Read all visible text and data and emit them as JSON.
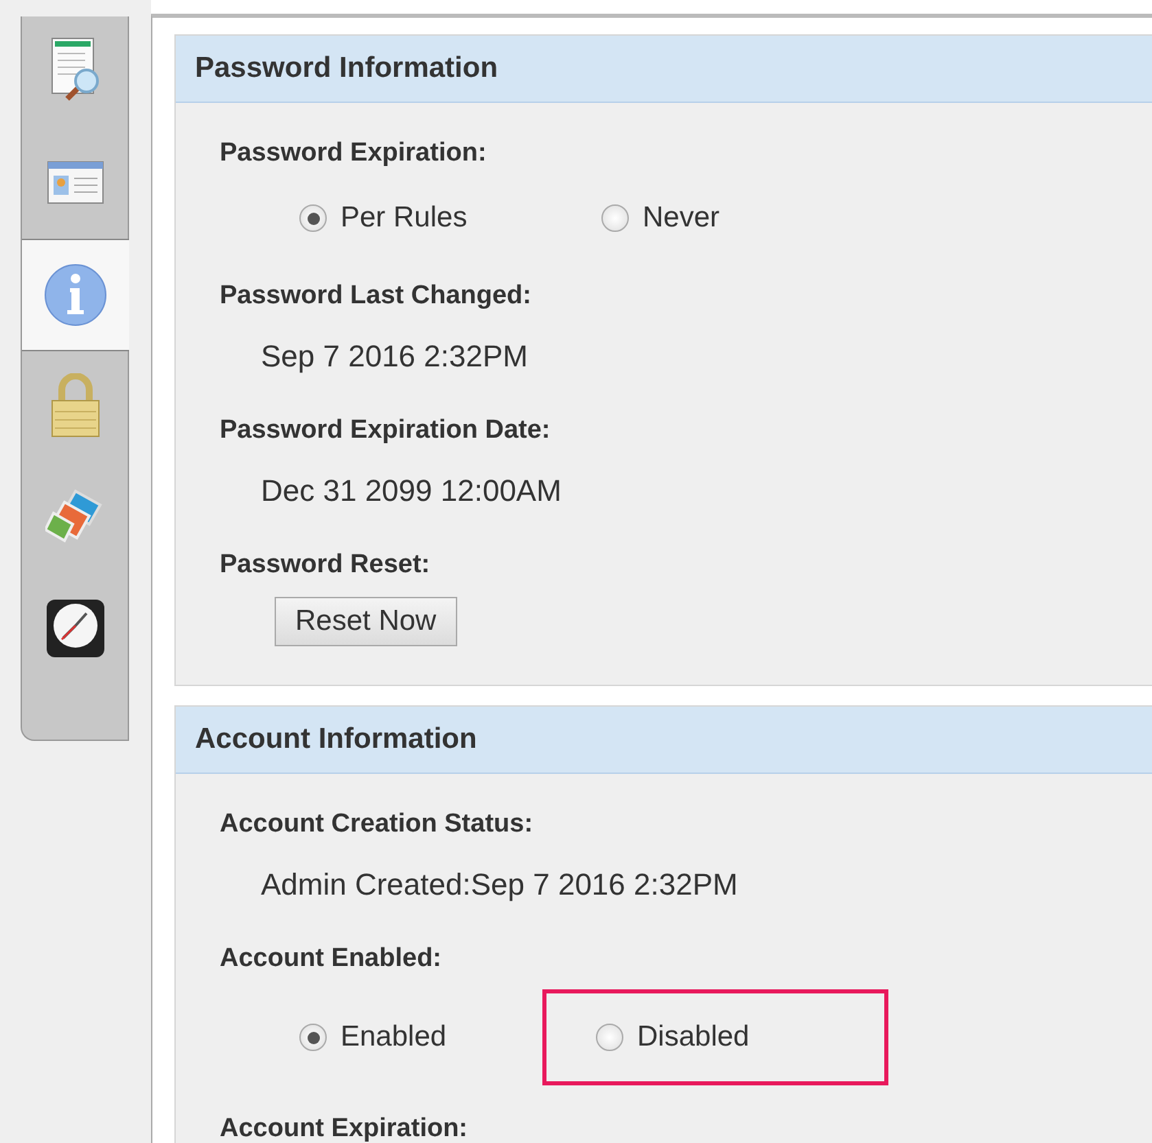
{
  "side_tabs": [
    {
      "kind": "report",
      "selected": false
    },
    {
      "kind": "card",
      "selected": false
    },
    {
      "kind": "info",
      "selected": true
    },
    {
      "kind": "lock",
      "selected": false
    },
    {
      "kind": "tags",
      "selected": false
    },
    {
      "kind": "clock",
      "selected": false
    }
  ],
  "sections": [
    {
      "title": "Password Information",
      "fields": [
        {
          "label": "Password Expiration:",
          "kind": "radio",
          "options": [
            {
              "label": "Per Rules",
              "selected": true,
              "highlighted": false
            },
            {
              "label": "Never",
              "selected": false,
              "highlighted": false
            }
          ]
        },
        {
          "label": "Password Last Changed:",
          "kind": "text",
          "value": "Sep 7 2016 2:32PM"
        },
        {
          "label": "Password Expiration Date:",
          "kind": "text",
          "value": "Dec 31 2099 12:00AM"
        },
        {
          "label": "Password Reset:",
          "kind": "button",
          "value": "Reset Now"
        }
      ]
    },
    {
      "title": "Account Information",
      "fields": [
        {
          "label": "Account Creation Status:",
          "kind": "text",
          "value": "Admin Created:Sep 7 2016 2:32PM"
        },
        {
          "label": "Account Enabled:",
          "kind": "radio",
          "options": [
            {
              "label": "Enabled",
              "selected": true,
              "highlighted": false
            },
            {
              "label": "Disabled",
              "selected": false,
              "highlighted": true
            }
          ]
        },
        {
          "label": "Account Expiration:",
          "kind": "label"
        }
      ]
    }
  ]
}
